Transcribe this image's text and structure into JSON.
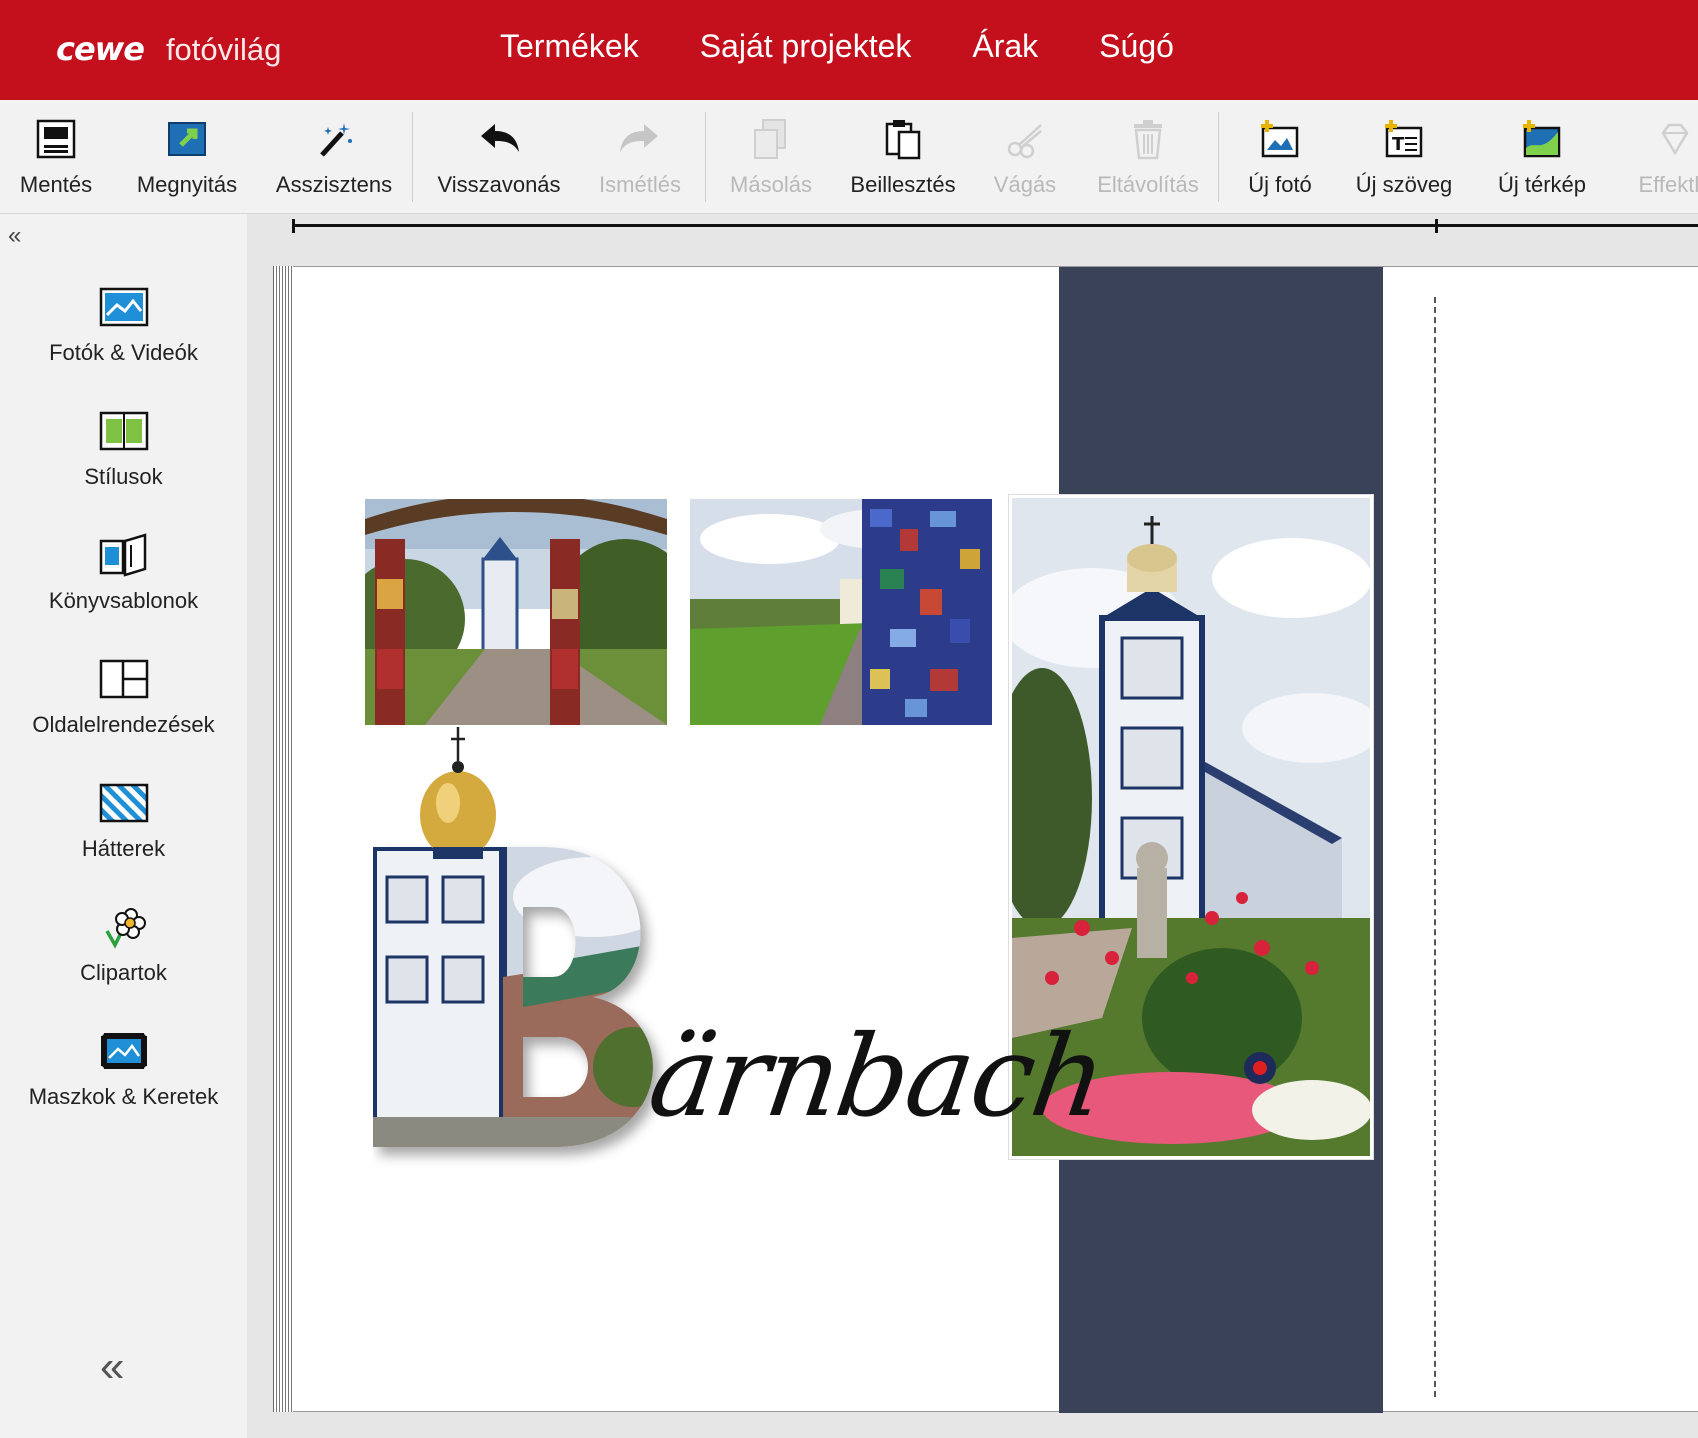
{
  "app": {
    "brand": "cewe",
    "product": "fotóvilág"
  },
  "topnav": {
    "items": [
      {
        "label": "Termékek"
      },
      {
        "label": "Saját projektek"
      },
      {
        "label": "Árak"
      },
      {
        "label": "Súgó"
      }
    ]
  },
  "toolbar": {
    "items": [
      {
        "label": "Mentés",
        "icon": "save-icon",
        "enabled": true
      },
      {
        "label": "Megnyitás",
        "icon": "open-icon",
        "enabled": true
      },
      {
        "label": "Asszisztens",
        "icon": "magic-wand-icon",
        "enabled": true
      },
      {
        "label": "Visszavonás",
        "icon": "undo-icon",
        "enabled": true
      },
      {
        "label": "Ismétlés",
        "icon": "redo-icon",
        "enabled": false
      },
      {
        "label": "Másolás",
        "icon": "copy-icon",
        "enabled": false
      },
      {
        "label": "Beillesztés",
        "icon": "paste-icon",
        "enabled": true
      },
      {
        "label": "Vágás",
        "icon": "scissors-icon",
        "enabled": false
      },
      {
        "label": "Eltávolítás",
        "icon": "trash-icon",
        "enabled": false
      },
      {
        "label": "Új fotó",
        "icon": "new-photo-icon",
        "enabled": true
      },
      {
        "label": "Új szöveg",
        "icon": "new-text-icon",
        "enabled": true
      },
      {
        "label": "Új térkép",
        "icon": "new-map-icon",
        "enabled": true
      },
      {
        "label": "Effektla",
        "icon": "effects-icon",
        "enabled": false
      }
    ]
  },
  "sidebar": {
    "collapse_top": "«",
    "collapse_bottom": "«",
    "items": [
      {
        "label": "Fotók & Videók",
        "icon": "photos-icon"
      },
      {
        "label": "Stílusok",
        "icon": "styles-icon"
      },
      {
        "label": "Könyvsablonok",
        "icon": "book-templates-icon"
      },
      {
        "label": "Oldalelrendezések",
        "icon": "page-layouts-icon"
      },
      {
        "label": "Hátterek",
        "icon": "backgrounds-icon"
      },
      {
        "label": "Clipartok",
        "icon": "clipart-icon"
      },
      {
        "label": "Maszkok & Keretek",
        "icon": "masks-frames-icon"
      }
    ]
  },
  "canvas": {
    "title_letter": "B",
    "title_rest": "ärnbach",
    "colors": {
      "stripe": "#394256",
      "brand_red": "#c4101c"
    }
  }
}
